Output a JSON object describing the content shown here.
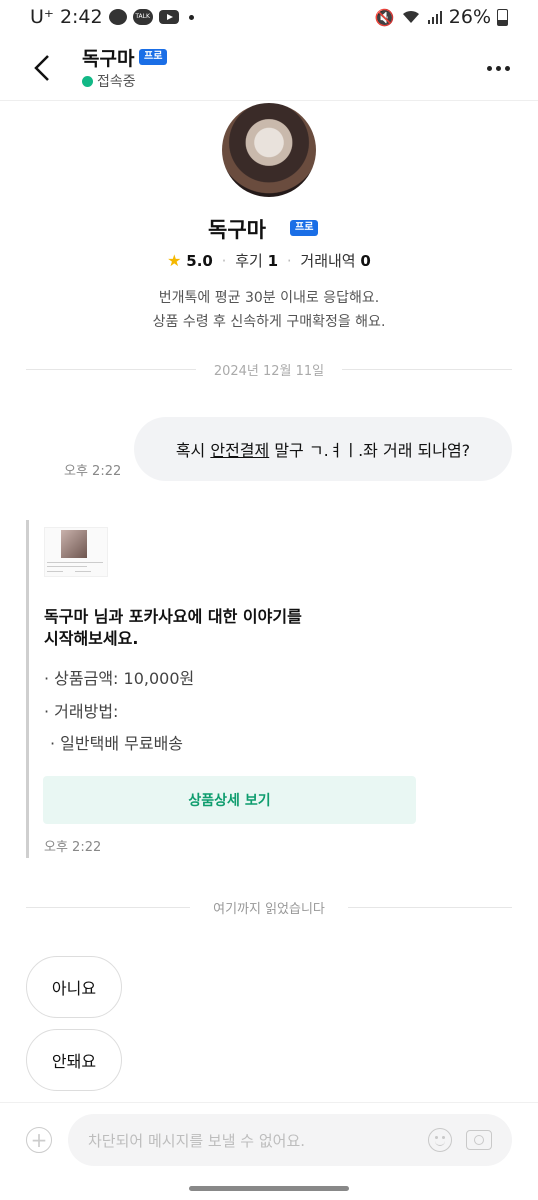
{
  "status_bar": {
    "carrier": "U⁺",
    "time": "2:42",
    "battery": "26%"
  },
  "header": {
    "name": "독구마",
    "badge": "프로",
    "status": "접속중"
  },
  "profile": {
    "name": "독구마",
    "badge": "프로",
    "rating": "5.0",
    "reviews_label": "후기",
    "reviews_count": "1",
    "trades_label": "거래내역",
    "trades_count": "0",
    "desc_line1": "번개톡에 평균 30분 이내로 응답해요.",
    "desc_line2": "상품 수령 후 신속하게 구매확정을 해요."
  },
  "chat": {
    "date": "2024년 12월 11일",
    "message": {
      "prefix": "혹시 ",
      "underlined": "안전결제",
      "suffix": " 말구 ㄱ.ㅕㅣ.좌 거래 되나염?",
      "time": "오후 2:22"
    },
    "card": {
      "title_line1": "독구마 님과 포카사요에 대한 이야기를",
      "title_line2": "시작해보세요.",
      "price": "· 상품금액: 10,000원",
      "method_label": "· 거래방법:",
      "method_value": "· 일반택배 무료배송",
      "button": "상품상세 보기",
      "time": "오후 2:22"
    },
    "read_marker": "여기까지 읽었습니다",
    "quick_replies": [
      "아니요",
      "안돼요"
    ]
  },
  "input": {
    "placeholder": "차단되어 메시지를 보낼 수 없어요."
  },
  "colors": {
    "accent_green": "#12b886",
    "pro_blue": "#1a6ee6",
    "button_bg": "#e9f7f3"
  }
}
